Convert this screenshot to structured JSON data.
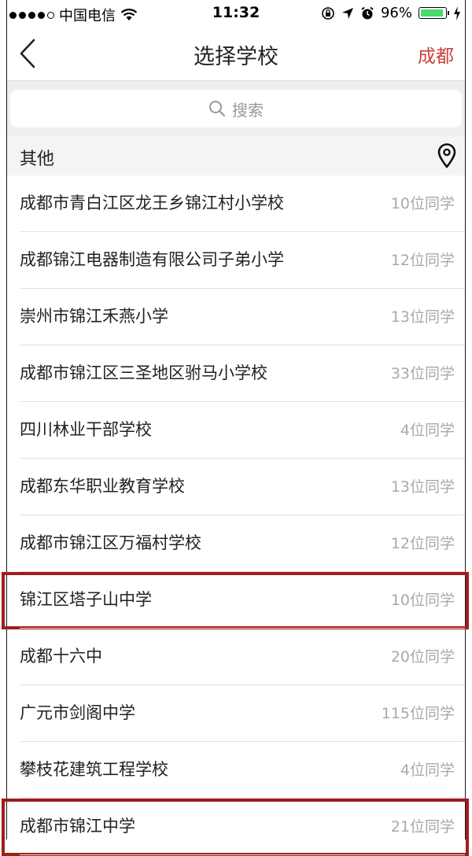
{
  "status_bar": {
    "carrier": "中国电信",
    "time": "11:32",
    "battery": "96%",
    "battery_level": 0.96
  },
  "nav": {
    "title": "选择学校",
    "city": "成都"
  },
  "search": {
    "placeholder": "搜索"
  },
  "section": {
    "title": "其他"
  },
  "schools": [
    {
      "name": "成都市青白江区龙王乡锦江村小学校",
      "count": "10位同学",
      "highlighted": false
    },
    {
      "name": "成都锦江电器制造有限公司子弟小学",
      "count": "12位同学",
      "highlighted": false
    },
    {
      "name": "崇州市锦江禾燕小学",
      "count": "13位同学",
      "highlighted": false
    },
    {
      "name": "成都市锦江区三圣地区驸马小学校",
      "count": "33位同学",
      "highlighted": false
    },
    {
      "name": "四川林业干部学校",
      "count": "4位同学",
      "highlighted": false
    },
    {
      "name": "成都东华职业教育学校",
      "count": "13位同学",
      "highlighted": false
    },
    {
      "name": "成都市锦江区万福村学校",
      "count": "12位同学",
      "highlighted": false
    },
    {
      "name": "锦江区塔子山中学",
      "count": "10位同学",
      "highlighted": true
    },
    {
      "name": "成都十六中",
      "count": "20位同学",
      "highlighted": false
    },
    {
      "name": "广元市剑阁中学",
      "count": "115位同学",
      "highlighted": false
    },
    {
      "name": "攀枝花建筑工程学校",
      "count": "4位同学",
      "highlighted": false
    },
    {
      "name": "成都市锦江中学",
      "count": "21位同学",
      "highlighted": true
    }
  ],
  "colors": {
    "accent": "#c8413b",
    "highlight_border": "#a31c1c",
    "battery": "#4cd964"
  }
}
